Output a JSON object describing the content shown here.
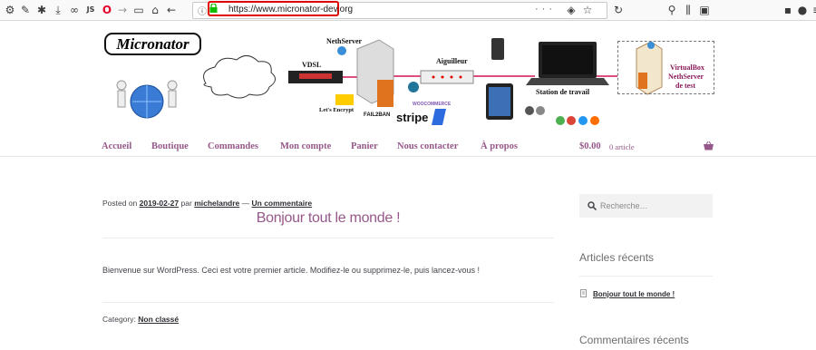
{
  "browser": {
    "url": "https://www.micronator-dev.org",
    "toolbar_icons": [
      "gear-icon",
      "wrench-icon",
      "puzzle-icon",
      "download-icon",
      "glasses-icon",
      "js-icon",
      "opera-icon",
      "forward-icon",
      "library-icon",
      "home-icon",
      "back-icon"
    ],
    "js_label": "JS",
    "page_actions": "···"
  },
  "banner": {
    "logo": "Micronator",
    "labels": {
      "nethserver": "NethServer",
      "vdsl": "VDSL",
      "aiguilleur": "Aiguilleur",
      "station": "Station de travail",
      "vbox1": "VirtualBox",
      "vbox2": "NethServer",
      "vbox3": "de test",
      "letsencrypt": "Let's Encrypt",
      "fail2ban": "FAIL2BAN",
      "woocommerce": "WOOCOMMERCE",
      "stripe": "stripe"
    }
  },
  "nav": {
    "items": [
      "Accueil",
      "Boutique",
      "Commandes",
      "Mon compte",
      "Panier",
      "Nous contacter",
      "À propos"
    ]
  },
  "cart": {
    "price": "$0.00",
    "count": "0 article"
  },
  "post": {
    "posted_on": "Posted on",
    "date": "2019-02-27",
    "by": "par",
    "author": "michelandre",
    "sep": "—",
    "comments": "Un commentaire",
    "title": "Bonjour tout le monde !",
    "content": "Bienvenue sur WordPress. Ceci est votre premier article. Modifiez-le ou supprimez-le, puis lancez-vous !",
    "category_label": "Category:",
    "category": "Non classé"
  },
  "sidebar": {
    "search_placeholder": "Recherche…",
    "recent_title": "Articles récents",
    "recent_items": [
      "Bonjour tout le monde !"
    ],
    "comments_title": "Commentaires récents"
  },
  "colors": {
    "accent": "#96588a",
    "url_highlight": "#e00000"
  }
}
